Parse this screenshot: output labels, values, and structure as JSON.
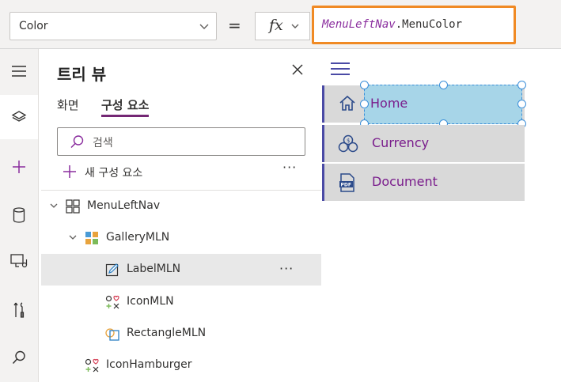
{
  "formula_bar": {
    "property": "Color",
    "equals": "=",
    "fx": "fx",
    "formula_object": "MenuLeftNav",
    "formula_member": ".MenuColor"
  },
  "rail": {
    "items": [
      "hamburger-icon",
      "layers-icon",
      "plus-icon",
      "database-icon",
      "media-icon",
      "tools-icon",
      "search-icon"
    ]
  },
  "tree_view": {
    "title": "트리 뷰",
    "tabs": [
      "화면",
      "구성 요소"
    ],
    "active_tab": "구성 요소",
    "search_placeholder": "검색",
    "new_component": "새 구성 요소",
    "more": "···",
    "nodes": [
      {
        "name": "MenuLeftNav",
        "icon": "component-icon"
      },
      {
        "name": "GalleryMLN",
        "icon": "gallery-icon"
      },
      {
        "name": "LabelMLN",
        "icon": "label-edit-icon",
        "selected": true
      },
      {
        "name": "IconMLN",
        "icon": "icon-control-icon"
      },
      {
        "name": "RectangleMLN",
        "icon": "shape-icon"
      },
      {
        "name": "IconHamburger",
        "icon": "icon-control-icon"
      }
    ]
  },
  "canvas": {
    "menu_items": [
      {
        "label": "Home",
        "icon": "home-icon"
      },
      {
        "label": "Currency",
        "icon": "currency-icon"
      },
      {
        "label": "Document",
        "icon": "pdf-icon"
      }
    ],
    "colors": {
      "menu_bg": "#d9d9d9",
      "menu_text": "#7a1d8c",
      "selection_fill": "#a7d5e8",
      "formula_highlight": "#f08a24"
    }
  }
}
